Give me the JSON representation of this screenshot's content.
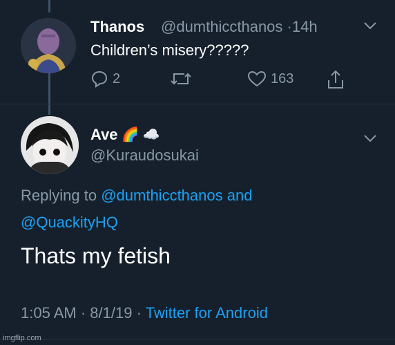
{
  "tweet_parent": {
    "display_name": "Thanos",
    "handle": "@dumthiccthanos",
    "separator": "·",
    "time": "14h",
    "text": "Children’s misery?????",
    "replies": "2",
    "likes": "163",
    "icons": [
      "reply-icon",
      "retweet-icon",
      "like-icon",
      "share-icon",
      "chevron-down-icon"
    ]
  },
  "tweet_main": {
    "display_name": "Ave",
    "display_emoji": "🌈 ☁️",
    "handle": "@Kuraudosukai",
    "replying_prefix": "Replying to",
    "reply_user_1": "@dumthiccthanos",
    "reply_and": "and",
    "reply_user_2": "@QuackityHQ",
    "text": "Thats my fetish",
    "time": "1:05 AM",
    "date": "8/1/19",
    "separator": "·",
    "source": "Twitter for Android"
  },
  "watermark": "imgflip.com",
  "colors": {
    "background": "#16202c",
    "accent": "#1da1f2",
    "muted": "#8899a6",
    "thread_line": "#3d5466"
  }
}
